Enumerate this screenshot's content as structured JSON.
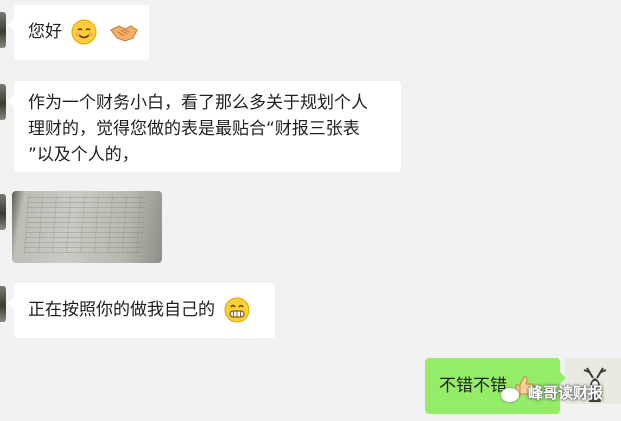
{
  "messages": [
    {
      "sender": "other",
      "text": "您好",
      "emojis": [
        "smile-emoji",
        "handshake-emoji"
      ]
    },
    {
      "sender": "other",
      "lines": [
        "作为一个财务小白，看了那么多关于规划个人",
        "理财的，觉得您做的表是最贴合“财报三张表",
        "”以及个人的，"
      ]
    },
    {
      "sender": "other",
      "type": "image"
    },
    {
      "sender": "other",
      "text": "正在按照你的做我自己的",
      "emojis": [
        "grin-emoji"
      ]
    },
    {
      "sender": "me",
      "text": "不错不错",
      "emojis": [
        "thumbs-up-emoji"
      ]
    }
  ],
  "watermark": {
    "text": "峰哥读财报"
  },
  "colors": {
    "background": "#f2f2f2",
    "other_bubble": "#ffffff",
    "my_bubble": "#95ec69"
  }
}
